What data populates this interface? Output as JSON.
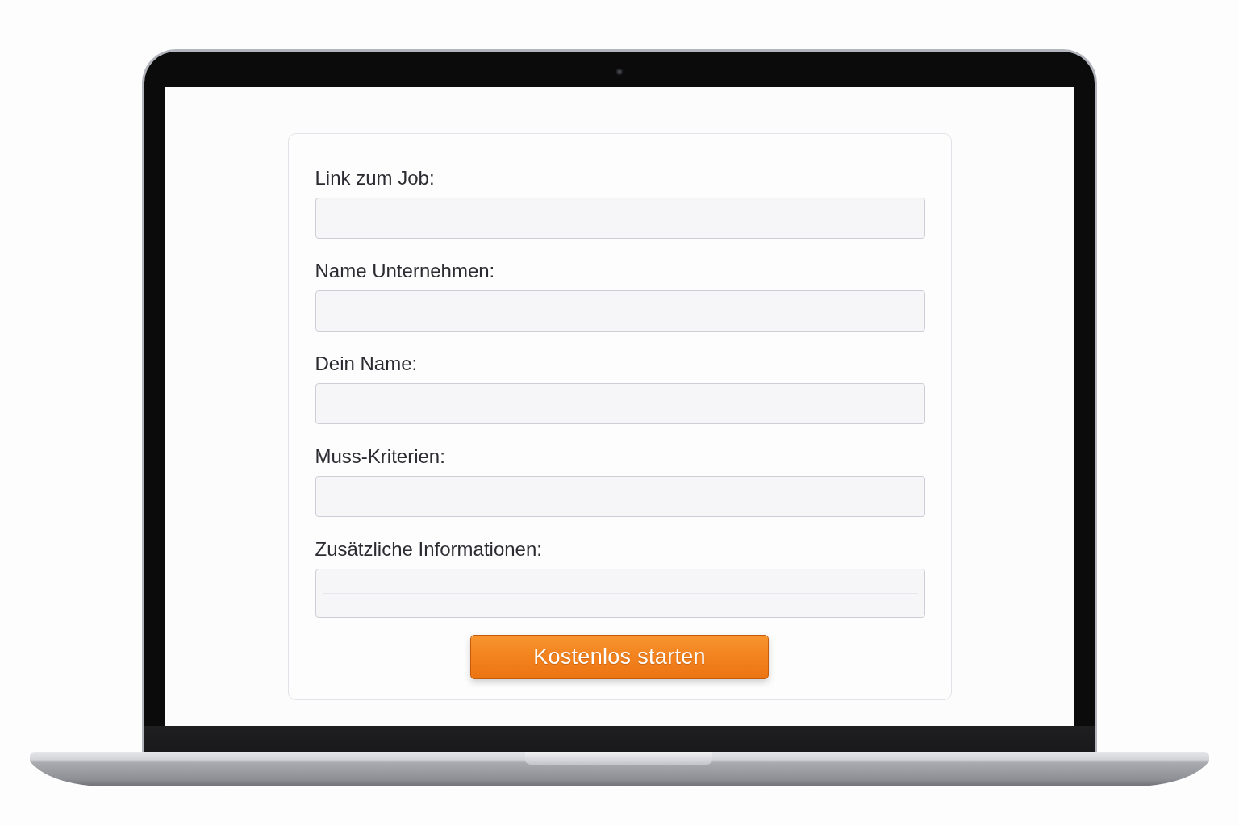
{
  "form": {
    "fields": [
      {
        "label": "Link zum Job:",
        "kind": "text"
      },
      {
        "label": "Name Unternehmen:",
        "kind": "text"
      },
      {
        "label": "Dein Name:",
        "kind": "text"
      },
      {
        "label": "Muss-Kriterien:",
        "kind": "text"
      },
      {
        "label": "Zusätzliche Informationen:",
        "kind": "textarea"
      }
    ],
    "submit_button": {
      "label": "Kostenlos starten"
    }
  }
}
